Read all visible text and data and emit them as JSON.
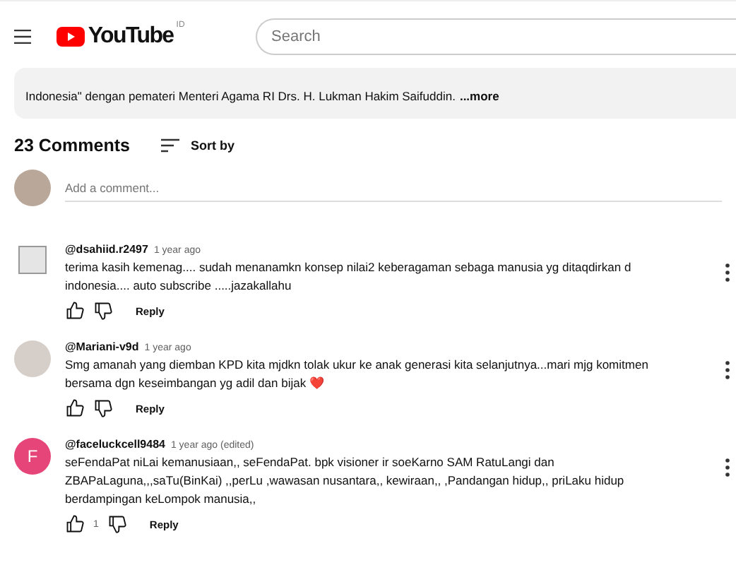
{
  "header": {
    "logo": "YouTube",
    "region": "ID",
    "search": {
      "placeholder": "Search"
    }
  },
  "description": {
    "text": "Indonesia\" dengan pemateri Menteri Agama RI Drs. H. Lukman Hakim Saifuddin.",
    "more": "...more"
  },
  "comments_header": {
    "count": "23 Comments",
    "sort": "Sort by"
  },
  "add_comment": {
    "placeholder": "Add a comment..."
  },
  "comments": [
    {
      "author": "@dsahiid.r2497",
      "time": "1 year ago",
      "avatar": {
        "kind": "image"
      },
      "text": "terima kasih kemenag.... sudah menanamkn konsep nilai2 keberagaman sebaga manusia yg ditaqdirkan d indonesia....   auto  subscribe .....jazakallahu",
      "reply": "Reply"
    },
    {
      "author": "@Mariani-v9d",
      "time": "1 year ago",
      "avatar": {
        "kind": "image"
      },
      "text": "Smg amanah yang diemban KPD kita mjdkn tolak ukur ke anak generasi kita selanjutnya...mari mjg komitmen bersama dgn keseimbangan yg adil dan bijak ❤️",
      "reply": "Reply"
    },
    {
      "author": "@faceluckcell9484",
      "time": "1 year ago (edited)",
      "avatar": {
        "kind": "letter",
        "letter": "F",
        "color": "#e6457a"
      },
      "text": "seFendaPat niLai kemanusiaan,, seFendaPat. bpk visioner ir soeKarno  SAM RatuLangi dan ZBAPaLaguna,,,saTu(BinKai) ,,perLu  ,wawasan nusantara,, kewiraan,, ,Pandangan hidup,, priLaku hidup berdampingan keLompok manusia,,",
      "likes": "1",
      "reply": "Reply"
    }
  ]
}
